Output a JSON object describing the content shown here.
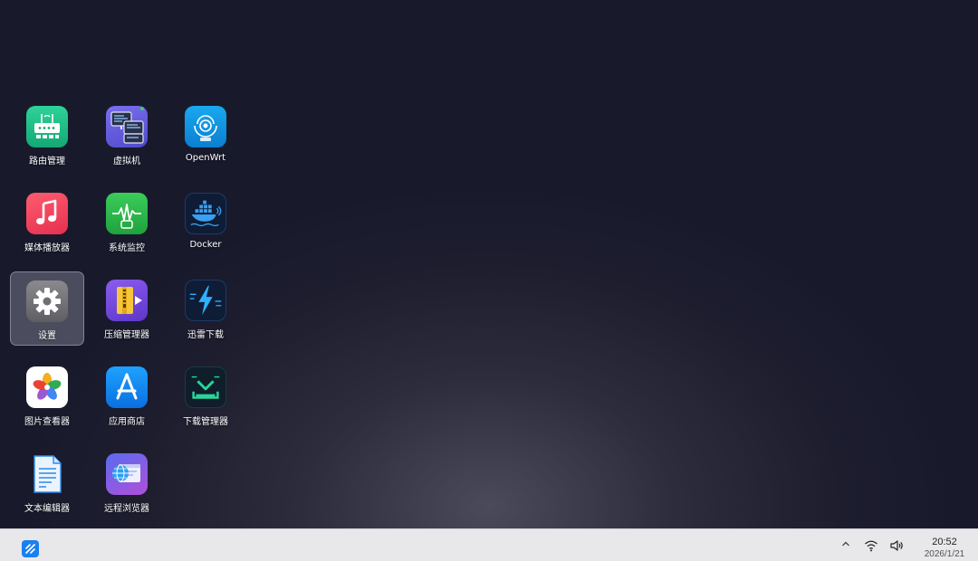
{
  "desktop": {
    "apps": [
      {
        "id": "router",
        "label": "路由管理",
        "icon": "router-icon"
      },
      {
        "id": "vm",
        "label": "虚拟机",
        "icon": "virtual-machine-icon"
      },
      {
        "id": "openwrt",
        "label": "OpenWrt",
        "icon": "openwrt-icon"
      },
      {
        "id": "media",
        "label": "媒体播放器",
        "icon": "music-note-icon"
      },
      {
        "id": "monitor",
        "label": "系统监控",
        "icon": "pulse-monitor-icon"
      },
      {
        "id": "docker",
        "label": "Docker",
        "icon": "docker-whale-icon"
      },
      {
        "id": "settings",
        "label": "设置",
        "icon": "gear-icon",
        "selected": true
      },
      {
        "id": "archive",
        "label": "压缩管理器",
        "icon": "archive-icon"
      },
      {
        "id": "thunder",
        "label": "迅雷下载",
        "icon": "lightning-icon"
      },
      {
        "id": "photos",
        "label": "图片查看器",
        "icon": "photo-flower-icon"
      },
      {
        "id": "appstore",
        "label": "应用商店",
        "icon": "app-store-icon"
      },
      {
        "id": "download",
        "label": "下载管理器",
        "icon": "download-tray-icon"
      },
      {
        "id": "editor",
        "label": "文本编辑器",
        "icon": "document-icon"
      },
      {
        "id": "browser",
        "label": "远程浏览器",
        "icon": "globe-browser-icon"
      }
    ]
  },
  "taskbar": {
    "start_icon": "start-logo-icon",
    "tray": {
      "chevron_icon": "chevron-up-icon",
      "wifi_icon": "wifi-icon",
      "volume_icon": "speaker-icon"
    },
    "clock": {
      "time": "20:52",
      "date": "2026/1/21"
    }
  },
  "colors": {
    "accent": "#1a7ff2",
    "desktop_bg": "#181a2c",
    "taskbar_bg": "#e8e8ea"
  }
}
